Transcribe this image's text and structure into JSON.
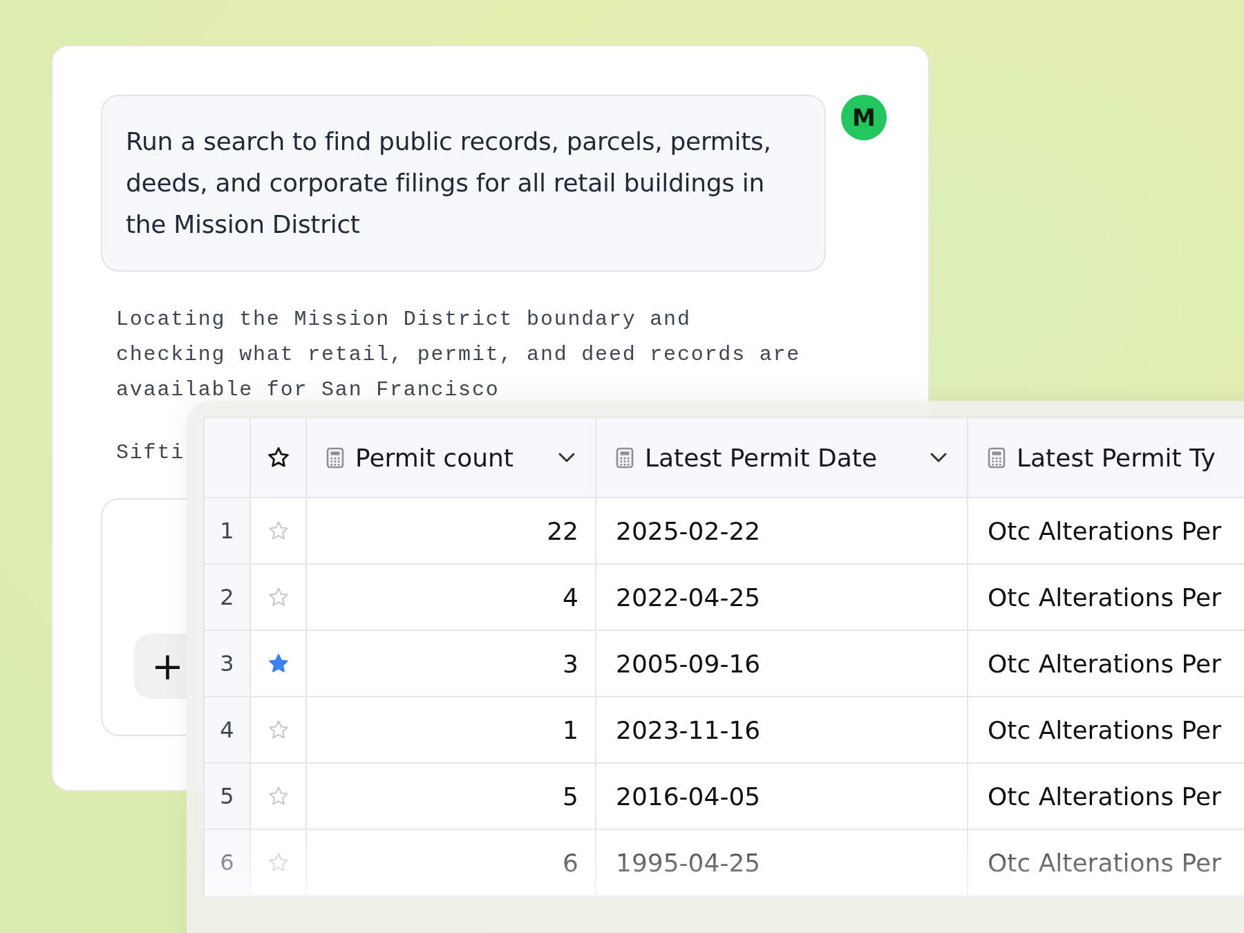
{
  "chat": {
    "avatar": "M",
    "prompt": "Run a search to find public records, parcels, permits, deeds, and corporate filings for all retail buildings in the Mission District",
    "status": [
      "Locating the Mission District boundary and\nchecking what retail, permit, and deed records are\navaailable for San Francisco",
      "Sifti"
    ],
    "add_button": "+"
  },
  "table": {
    "columns": [
      {
        "label": "Permit count",
        "kind": "number"
      },
      {
        "label": "Latest Permit Date",
        "kind": "text"
      },
      {
        "label": "Latest Permit Ty",
        "kind": "text"
      }
    ],
    "rows": [
      {
        "index": "1",
        "starred": false,
        "cells": [
          "22",
          "2025-02-22",
          "Otc Alterations Per"
        ]
      },
      {
        "index": "2",
        "starred": false,
        "cells": [
          "4",
          "2022-04-25",
          "Otc Alterations Per"
        ]
      },
      {
        "index": "3",
        "starred": true,
        "cells": [
          "3",
          "2005-09-16",
          "Otc Alterations Per"
        ]
      },
      {
        "index": "4",
        "starred": false,
        "cells": [
          "1",
          "2023-11-16",
          "Otc Alterations Per"
        ]
      },
      {
        "index": "5",
        "starred": false,
        "cells": [
          "5",
          "2016-04-05",
          "Otc Alterations Per"
        ]
      },
      {
        "index": "6",
        "starred": false,
        "cells": [
          "6",
          "1995-04-25",
          "Otc Alterations Per"
        ]
      }
    ]
  }
}
